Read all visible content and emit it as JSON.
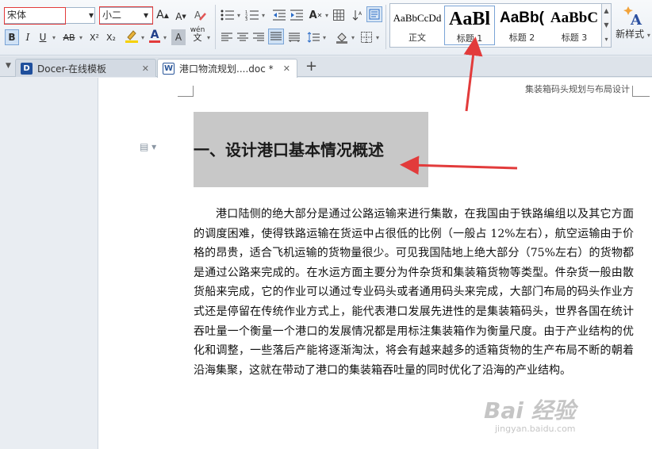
{
  "font_controls": {
    "font_name": "宋体",
    "font_size": "小二"
  },
  "toolbar": {
    "grow_font": "A",
    "shrink_font": "A",
    "bold": "B",
    "italic": "I",
    "underline": "U",
    "strike": "AB",
    "superscript": "X²",
    "subscript": "X₂",
    "font_color": "A",
    "shading": "A",
    "phonetic": "wén",
    "text_direction": "A"
  },
  "styles_gallery": {
    "items": [
      {
        "sample": "AaBbCcDd",
        "name": "正文"
      },
      {
        "sample": "AaBl",
        "name": "标题 1"
      },
      {
        "sample": "AaBb(",
        "name": "标题 2"
      },
      {
        "sample": "AaBbC",
        "name": "标题 3"
      }
    ],
    "new_style_label": "新样式"
  },
  "tabs": [
    {
      "label": "Docer-在线模板",
      "icon": "docer-icon"
    },
    {
      "label": "港口物流规划....doc *",
      "icon": "word-doc-icon"
    }
  ],
  "document": {
    "header": "集装箱码头规划与布局设计",
    "heading": "一、设计港口基本情况概述",
    "body": "港口陆侧的绝大部分是通过公路运输来进行集散，在我国由于铁路编组以及其它方面的调度困难，使得铁路运输在货运中占很低的比例（一般占 12%左右），航空运输由于价格的昂贵，适合飞机运输的货物量很少。可见我国陆地上绝大部分（75%左右）的货物都是通过公路来完成的。在水运方面主要分为件杂货和集装箱货物等类型。件杂货一般由散货船来完成，它的作业可以通过专业码头或者通用码头来完成，大部门布局的码头作业方式还是停留在传统作业方式上，能代表港口发展先进性的是集装箱码头，世界各国在统计吞吐量一个衡量一个港口的发展情况都是用标注集装箱作为衡量尺度。由于产业结构的优化和调整，一些落后产能将逐渐淘汰，将会有越来越多的适箱货物的生产布局不断的朝着沿海集聚，这就在带动了港口的集装箱吞吐量的同时优化了沿海的产业结构。"
  },
  "watermark": {
    "logo": "Bai 经验",
    "url": "jingyan.baidu.com"
  },
  "colors": {
    "annotation_red": "#e23b3b",
    "heading_highlight": "#c8c8c8",
    "font_color_bar": "#e23b3b",
    "highlight_bar": "#f5d000"
  }
}
